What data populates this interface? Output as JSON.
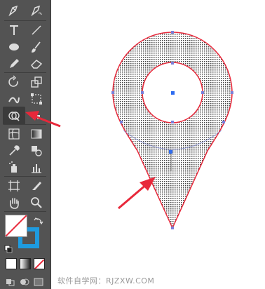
{
  "toolbar": {
    "tools": [
      {
        "name": "pen-tool-icon",
        "col": 0,
        "row": 0
      },
      {
        "name": "curvature-tool-icon",
        "col": 1,
        "row": 0
      },
      {
        "name": "type-tool-icon",
        "col": 0,
        "row": 1
      },
      {
        "name": "line-segment-tool-icon",
        "col": 1,
        "row": 1
      },
      {
        "name": "ellipse-tool-icon",
        "col": 0,
        "row": 2
      },
      {
        "name": "paintbrush-tool-icon",
        "col": 1,
        "row": 2
      },
      {
        "name": "pencil-tool-icon",
        "col": 0,
        "row": 3
      },
      {
        "name": "eraser-tool-icon",
        "col": 1,
        "row": 3
      },
      {
        "name": "rotate-tool-icon",
        "col": 0,
        "row": 4
      },
      {
        "name": "scale-tool-icon",
        "col": 1,
        "row": 4
      },
      {
        "name": "width-tool-icon",
        "col": 0,
        "row": 5
      },
      {
        "name": "free-transform-tool-icon",
        "col": 1,
        "row": 5
      },
      {
        "name": "shape-builder-tool-icon",
        "col": 0,
        "row": 6
      },
      {
        "name": "live-paint-tool-icon",
        "col": 1,
        "row": 6
      },
      {
        "name": "mesh-tool-icon",
        "col": 0,
        "row": 7
      },
      {
        "name": "gradient-tool-icon",
        "col": 1,
        "row": 7
      },
      {
        "name": "eyedropper-tool-icon",
        "col": 0,
        "row": 8
      },
      {
        "name": "blend-tool-icon",
        "col": 1,
        "row": 8
      },
      {
        "name": "symbol-sprayer-tool-icon",
        "col": 0,
        "row": 9
      },
      {
        "name": "column-graph-tool-icon",
        "col": 1,
        "row": 9
      },
      {
        "name": "artboard-tool-icon",
        "col": 0,
        "row": 10
      },
      {
        "name": "slice-tool-icon",
        "col": 1,
        "row": 10
      },
      {
        "name": "hand-tool-icon",
        "col": 0,
        "row": 11
      },
      {
        "name": "zoom-tool-icon",
        "col": 1,
        "row": 11
      }
    ],
    "active_tool": "shape-builder-tool-icon",
    "fill_color": "#ffffff",
    "stroke_color": "#1e9be0"
  },
  "watermark": "软件自学网：RJZXW.COM",
  "colors": {
    "accent": "#e8283a",
    "anchor": "#4a6cf0",
    "toolbar_bg": "#535353"
  }
}
